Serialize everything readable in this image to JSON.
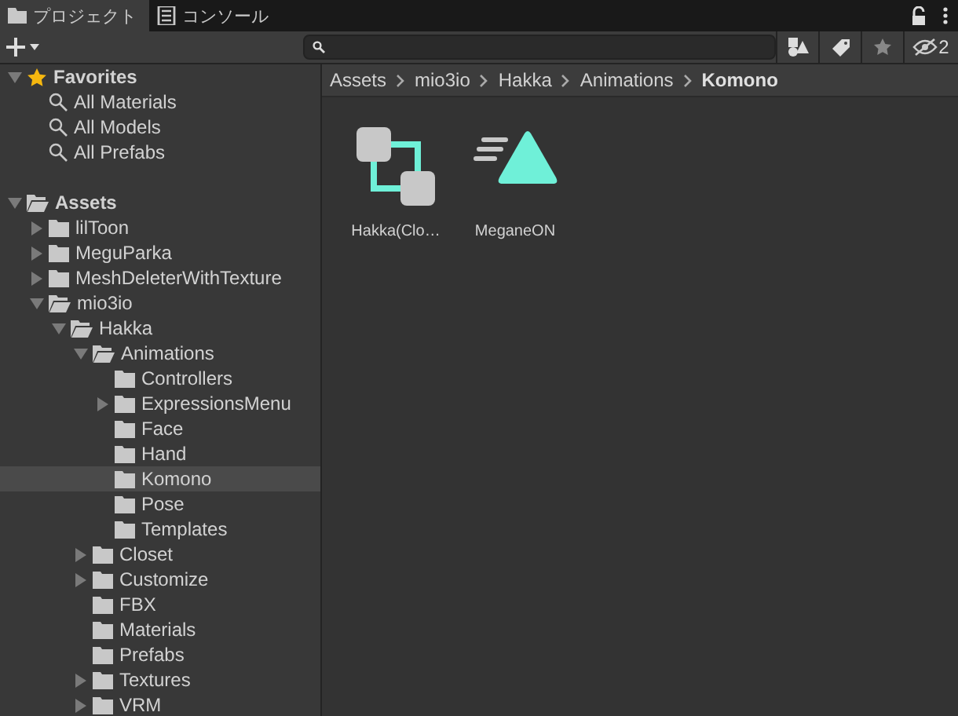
{
  "tabs": [
    {
      "label": "プロジェクト",
      "kind": "folder",
      "selected": true
    },
    {
      "label": "コンソール",
      "kind": "console",
      "selected": false
    }
  ],
  "toolbar": {
    "hidden_count": "2"
  },
  "tree": [
    {
      "label": "Favorites",
      "kind": "favorites",
      "expandable": true,
      "expanded": true,
      "selected": false,
      "children": [
        {
          "label": "All Materials",
          "kind": "search",
          "selected": false
        },
        {
          "label": "All Models",
          "kind": "search",
          "selected": false
        },
        {
          "label": "All Prefabs",
          "kind": "search",
          "selected": false
        }
      ]
    },
    {
      "label": "Assets",
      "kind": "root",
      "expandable": true,
      "expanded": true,
      "selected": false,
      "children": [
        {
          "label": "lilToon",
          "kind": "folder",
          "expandable": true,
          "expanded": false,
          "selected": false
        },
        {
          "label": "MeguParka",
          "kind": "folder",
          "expandable": true,
          "expanded": false,
          "selected": false
        },
        {
          "label": "MeshDeleterWithTexture",
          "kind": "folder",
          "expandable": true,
          "expanded": false,
          "selected": false
        },
        {
          "label": "mio3io",
          "kind": "folder",
          "expandable": true,
          "expanded": true,
          "selected": false,
          "children": [
            {
              "label": "Hakka",
              "kind": "folder",
              "expandable": true,
              "expanded": true,
              "selected": false,
              "children": [
                {
                  "label": "Animations",
                  "kind": "folder",
                  "expandable": true,
                  "expanded": true,
                  "selected": false,
                  "children": [
                    {
                      "label": "Controllers",
                      "kind": "folder",
                      "expandable": false,
                      "selected": false
                    },
                    {
                      "label": "ExpressionsMenu",
                      "kind": "folder",
                      "expandable": true,
                      "expanded": false,
                      "selected": false
                    },
                    {
                      "label": "Face",
                      "kind": "folder",
                      "expandable": false,
                      "selected": false
                    },
                    {
                      "label": "Hand",
                      "kind": "folder",
                      "expandable": false,
                      "selected": false
                    },
                    {
                      "label": "Komono",
                      "kind": "folder",
                      "expandable": false,
                      "selected": true
                    },
                    {
                      "label": "Pose",
                      "kind": "folder",
                      "expandable": false,
                      "selected": false
                    },
                    {
                      "label": "Templates",
                      "kind": "folder",
                      "expandable": false,
                      "selected": false
                    }
                  ]
                },
                {
                  "label": "Closet",
                  "kind": "folder",
                  "expandable": true,
                  "expanded": false,
                  "selected": false
                },
                {
                  "label": "Customize",
                  "kind": "folder",
                  "expandable": true,
                  "expanded": false,
                  "selected": false
                },
                {
                  "label": "FBX",
                  "kind": "folder",
                  "expandable": false,
                  "selected": false
                },
                {
                  "label": "Materials",
                  "kind": "folder",
                  "expandable": false,
                  "selected": false
                },
                {
                  "label": "Prefabs",
                  "kind": "folder",
                  "expandable": false,
                  "selected": false
                },
                {
                  "label": "Textures",
                  "kind": "folder",
                  "expandable": true,
                  "expanded": false,
                  "selected": false
                },
                {
                  "label": "VRM",
                  "kind": "folder",
                  "expandable": true,
                  "expanded": false,
                  "selected": false
                }
              ]
            }
          ]
        }
      ]
    }
  ],
  "breadcrumb": [
    "Assets",
    "mio3io",
    "Hakka",
    "Animations",
    "Komono"
  ],
  "assets": [
    {
      "label": "Hakka(Clo…",
      "kind": "controller"
    },
    {
      "label": "MeganeON",
      "kind": "clip"
    }
  ]
}
